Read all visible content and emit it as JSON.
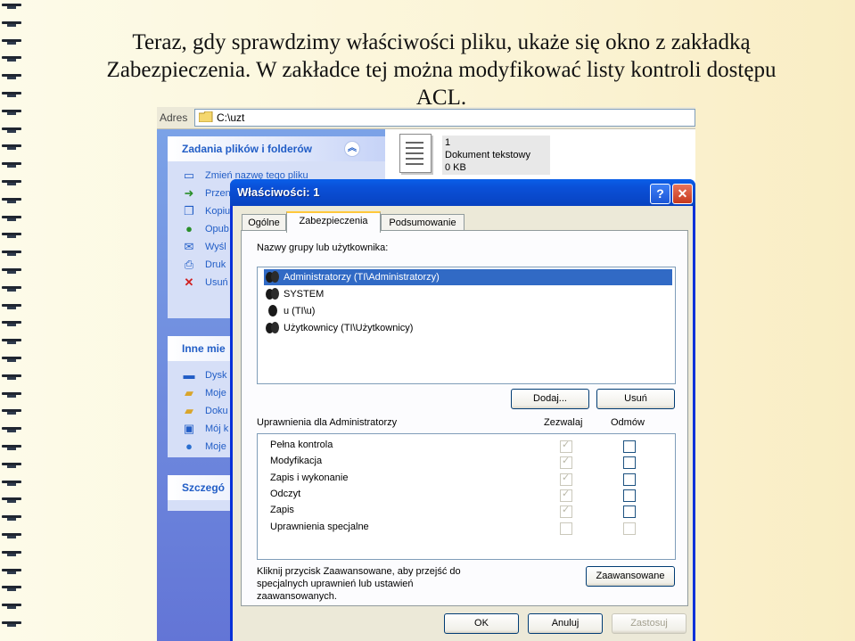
{
  "caption": {
    "line1": "Teraz, gdy sprawdzimy właściwości pliku, ukaże się okno z zakładką",
    "line2": "Zabezpieczenia. W zakładce tej można modyfikować listy kontroli dostępu",
    "line3": "ACL."
  },
  "explorer": {
    "address_label": "Adres",
    "address_value": "C:\\uzt",
    "file_tasks": {
      "title": "Zadania plików i folderów",
      "items": [
        "Zmień nazwę tego pliku",
        "Przen",
        "Kopiu",
        "Opub",
        "Wyśl",
        "Druk",
        "Usuń"
      ]
    },
    "other_places": {
      "title": "Inne mie",
      "items": [
        "Dysk",
        "Moje",
        "Doku",
        "Mój k",
        "Moje"
      ]
    },
    "details": {
      "title": "Szczegó"
    },
    "file": {
      "name": "1",
      "type": "Dokument tekstowy",
      "size": "0 KB"
    }
  },
  "dialog": {
    "title": "Właściwości: 1",
    "help": "?",
    "close": "✕",
    "tabs": [
      "Ogólne",
      "Zabezpieczenia",
      "Podsumowanie"
    ],
    "groups_label": "Nazwy grupy lub użytkownika:",
    "users": [
      "Administratorzy (TI\\Administratorzy)",
      "SYSTEM",
      "u (TI\\u)",
      "Użytkownicy (TI\\Użytkownicy)"
    ],
    "add_button": "Dodaj...",
    "remove_button": "Usuń",
    "permissions_label": "Uprawnienia dla Administratorzy",
    "allow_header": "Zezwalaj",
    "deny_header": "Odmów",
    "permissions": [
      {
        "name": "Pełna kontrola",
        "allow": true,
        "deny": false
      },
      {
        "name": "Modyfikacja",
        "allow": true,
        "deny": false
      },
      {
        "name": "Zapis i wykonanie",
        "allow": true,
        "deny": false
      },
      {
        "name": "Odczyt",
        "allow": true,
        "deny": false
      },
      {
        "name": "Zapis",
        "allow": true,
        "deny": false
      },
      {
        "name": "Uprawnienia specjalne",
        "allow": false,
        "deny": false
      }
    ],
    "advanced_text_1": "Kliknij przycisk Zaawansowane, aby przejść do",
    "advanced_text_2": "specjalnych uprawnień lub ustawień",
    "advanced_text_3": "zaawansowanych.",
    "advanced_button": "Zaawansowane",
    "ok": "OK",
    "cancel": "Anuluj",
    "apply": "Zastosuj"
  }
}
